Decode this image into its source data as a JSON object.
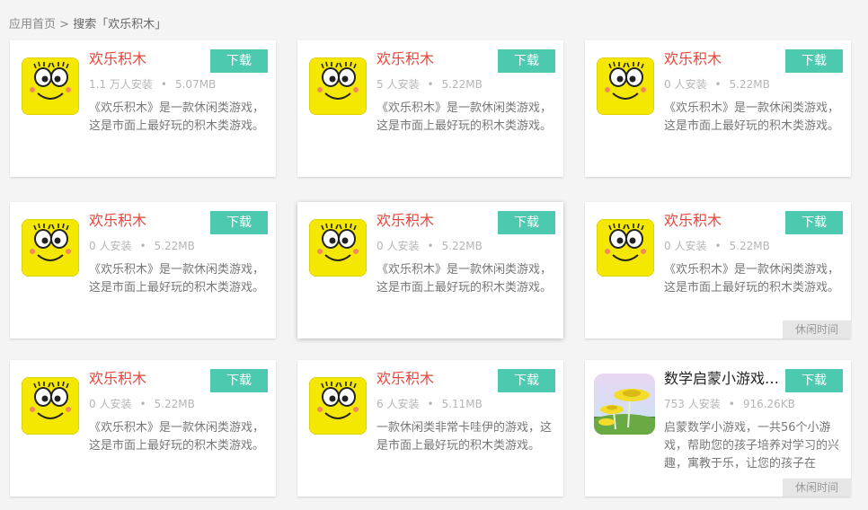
{
  "breadcrumb": {
    "home": "应用首页",
    "separator": ">",
    "current": "搜索「欢乐积木」"
  },
  "download_label": "下载",
  "cards": [
    {
      "title": "欢乐积木",
      "installs": "1.1 万人安装",
      "size": "5.07MB",
      "desc": "《欢乐积木》是一款休闲类游戏，这是市面上最好玩的积木类游戏。",
      "icon": "smiley-face-icon",
      "tag": ""
    },
    {
      "title": "欢乐积木",
      "installs": "5 人安装",
      "size": "5.22MB",
      "desc": "《欢乐积木》是一款休闲类游戏，这是市面上最好玩的积木类游戏。",
      "icon": "smiley-face-icon",
      "tag": ""
    },
    {
      "title": "欢乐积木",
      "installs": "0 人安装",
      "size": "5.22MB",
      "desc": "《欢乐积木》是一款休闲类游戏，这是市面上最好玩的积木类游戏。",
      "icon": "smiley-face-icon",
      "tag": ""
    },
    {
      "title": "欢乐积木",
      "installs": "0 人安装",
      "size": "5.22MB",
      "desc": "《欢乐积木》是一款休闲类游戏，这是市面上最好玩的积木类游戏。",
      "icon": "smiley-face-icon",
      "tag": ""
    },
    {
      "title": "欢乐积木",
      "installs": "0 人安装",
      "size": "5.22MB",
      "desc": "《欢乐积木》是一款休闲类游戏，这是市面上最好玩的积木类游戏。",
      "icon": "smiley-face-icon",
      "tag": ""
    },
    {
      "title": "欢乐积木",
      "installs": "0 人安装",
      "size": "5.22MB",
      "desc": "《欢乐积木》是一款休闲类游戏，这是市面上最好玩的积木类游戏。",
      "icon": "smiley-face-icon",
      "tag": "休闲时间"
    },
    {
      "title": "欢乐积木",
      "installs": "0 人安装",
      "size": "5.22MB",
      "desc": "《欢乐积木》是一款休闲类游戏，这是市面上最好玩的积木类游戏。",
      "icon": "smiley-face-icon",
      "tag": ""
    },
    {
      "title": "欢乐积木",
      "installs": "6 人安装",
      "size": "5.11MB",
      "desc": "一款休闲类非常卡哇伊的游戏，这是市面上最好玩的积木类游戏。",
      "icon": "smiley-face-icon",
      "tag": ""
    },
    {
      "title": "数学启蒙小游戏…",
      "installs": "753 人安装",
      "size": "916.26KB",
      "desc": "启蒙数学小游戏，一共56个小游戏，帮助您的孩子培养对学习的兴趣，寓教于乐，让您的孩子在",
      "icon": "dandelion-flower-icon",
      "tag": "休闲时间"
    }
  ]
}
